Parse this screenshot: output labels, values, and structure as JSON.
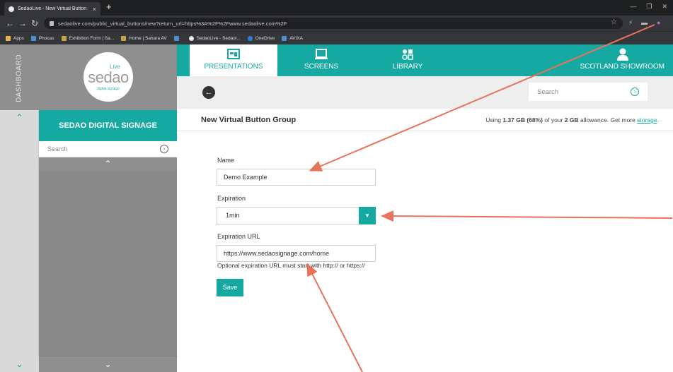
{
  "browser": {
    "tab_title": "SedaoLive - New Virtual Button",
    "tab_close": "×",
    "new_tab": "+",
    "url": "sedaolive.com/public_virtual_buttons/new?return_url=https%3A%2F%2Fwww.sedaolive.com%2F",
    "bookmarks": [
      "Apps",
      "Phocas",
      "Exhibition Form | Sa...",
      "Home | Sahara AV",
      "",
      "SedaoLive - Sedaol...",
      "OneDrive",
      "AVIXA"
    ]
  },
  "app": {
    "dashboard_label": "DASHBOARD",
    "logo": {
      "live": "Live",
      "word": "sedao",
      "tagline": "digital signage"
    },
    "brand_title": "SEDAO DIGITAL SIGNAGE",
    "side_search_placeholder": "Search",
    "nav": [
      {
        "label": "PRESENTATIONS",
        "icon": "presentations-icon",
        "active": true
      },
      {
        "label": "SCREENS",
        "icon": "screens-icon",
        "active": false
      },
      {
        "label": "LIBRARY",
        "icon": "library-icon",
        "active": false
      }
    ],
    "user_label": "SCOTLAND SHOWROOM",
    "top_search_placeholder": "Search",
    "page_title": "New Virtual Button Group",
    "usage": {
      "prefix": "Using ",
      "used": "1.37 GB (68%)",
      "middle": " of your ",
      "allowance": "2 GB",
      "suffix": " allowance. Get more ",
      "link": "storage",
      "end": "."
    }
  },
  "form": {
    "name_label": "Name",
    "name_value": "Demo Example",
    "expiration_label": "Expiration",
    "expiration_value": "1min",
    "expiration_url_label": "Expiration URL",
    "expiration_url_value": "https://www.sedaosignage.com/home",
    "expiration_url_help": "Optional expiration URL must start with http:// or https://",
    "save_label": "Save"
  },
  "colors": {
    "accent": "#16a9a2",
    "sidebar": "#8a8a8a",
    "annotation_arrow": "#e8735b"
  }
}
